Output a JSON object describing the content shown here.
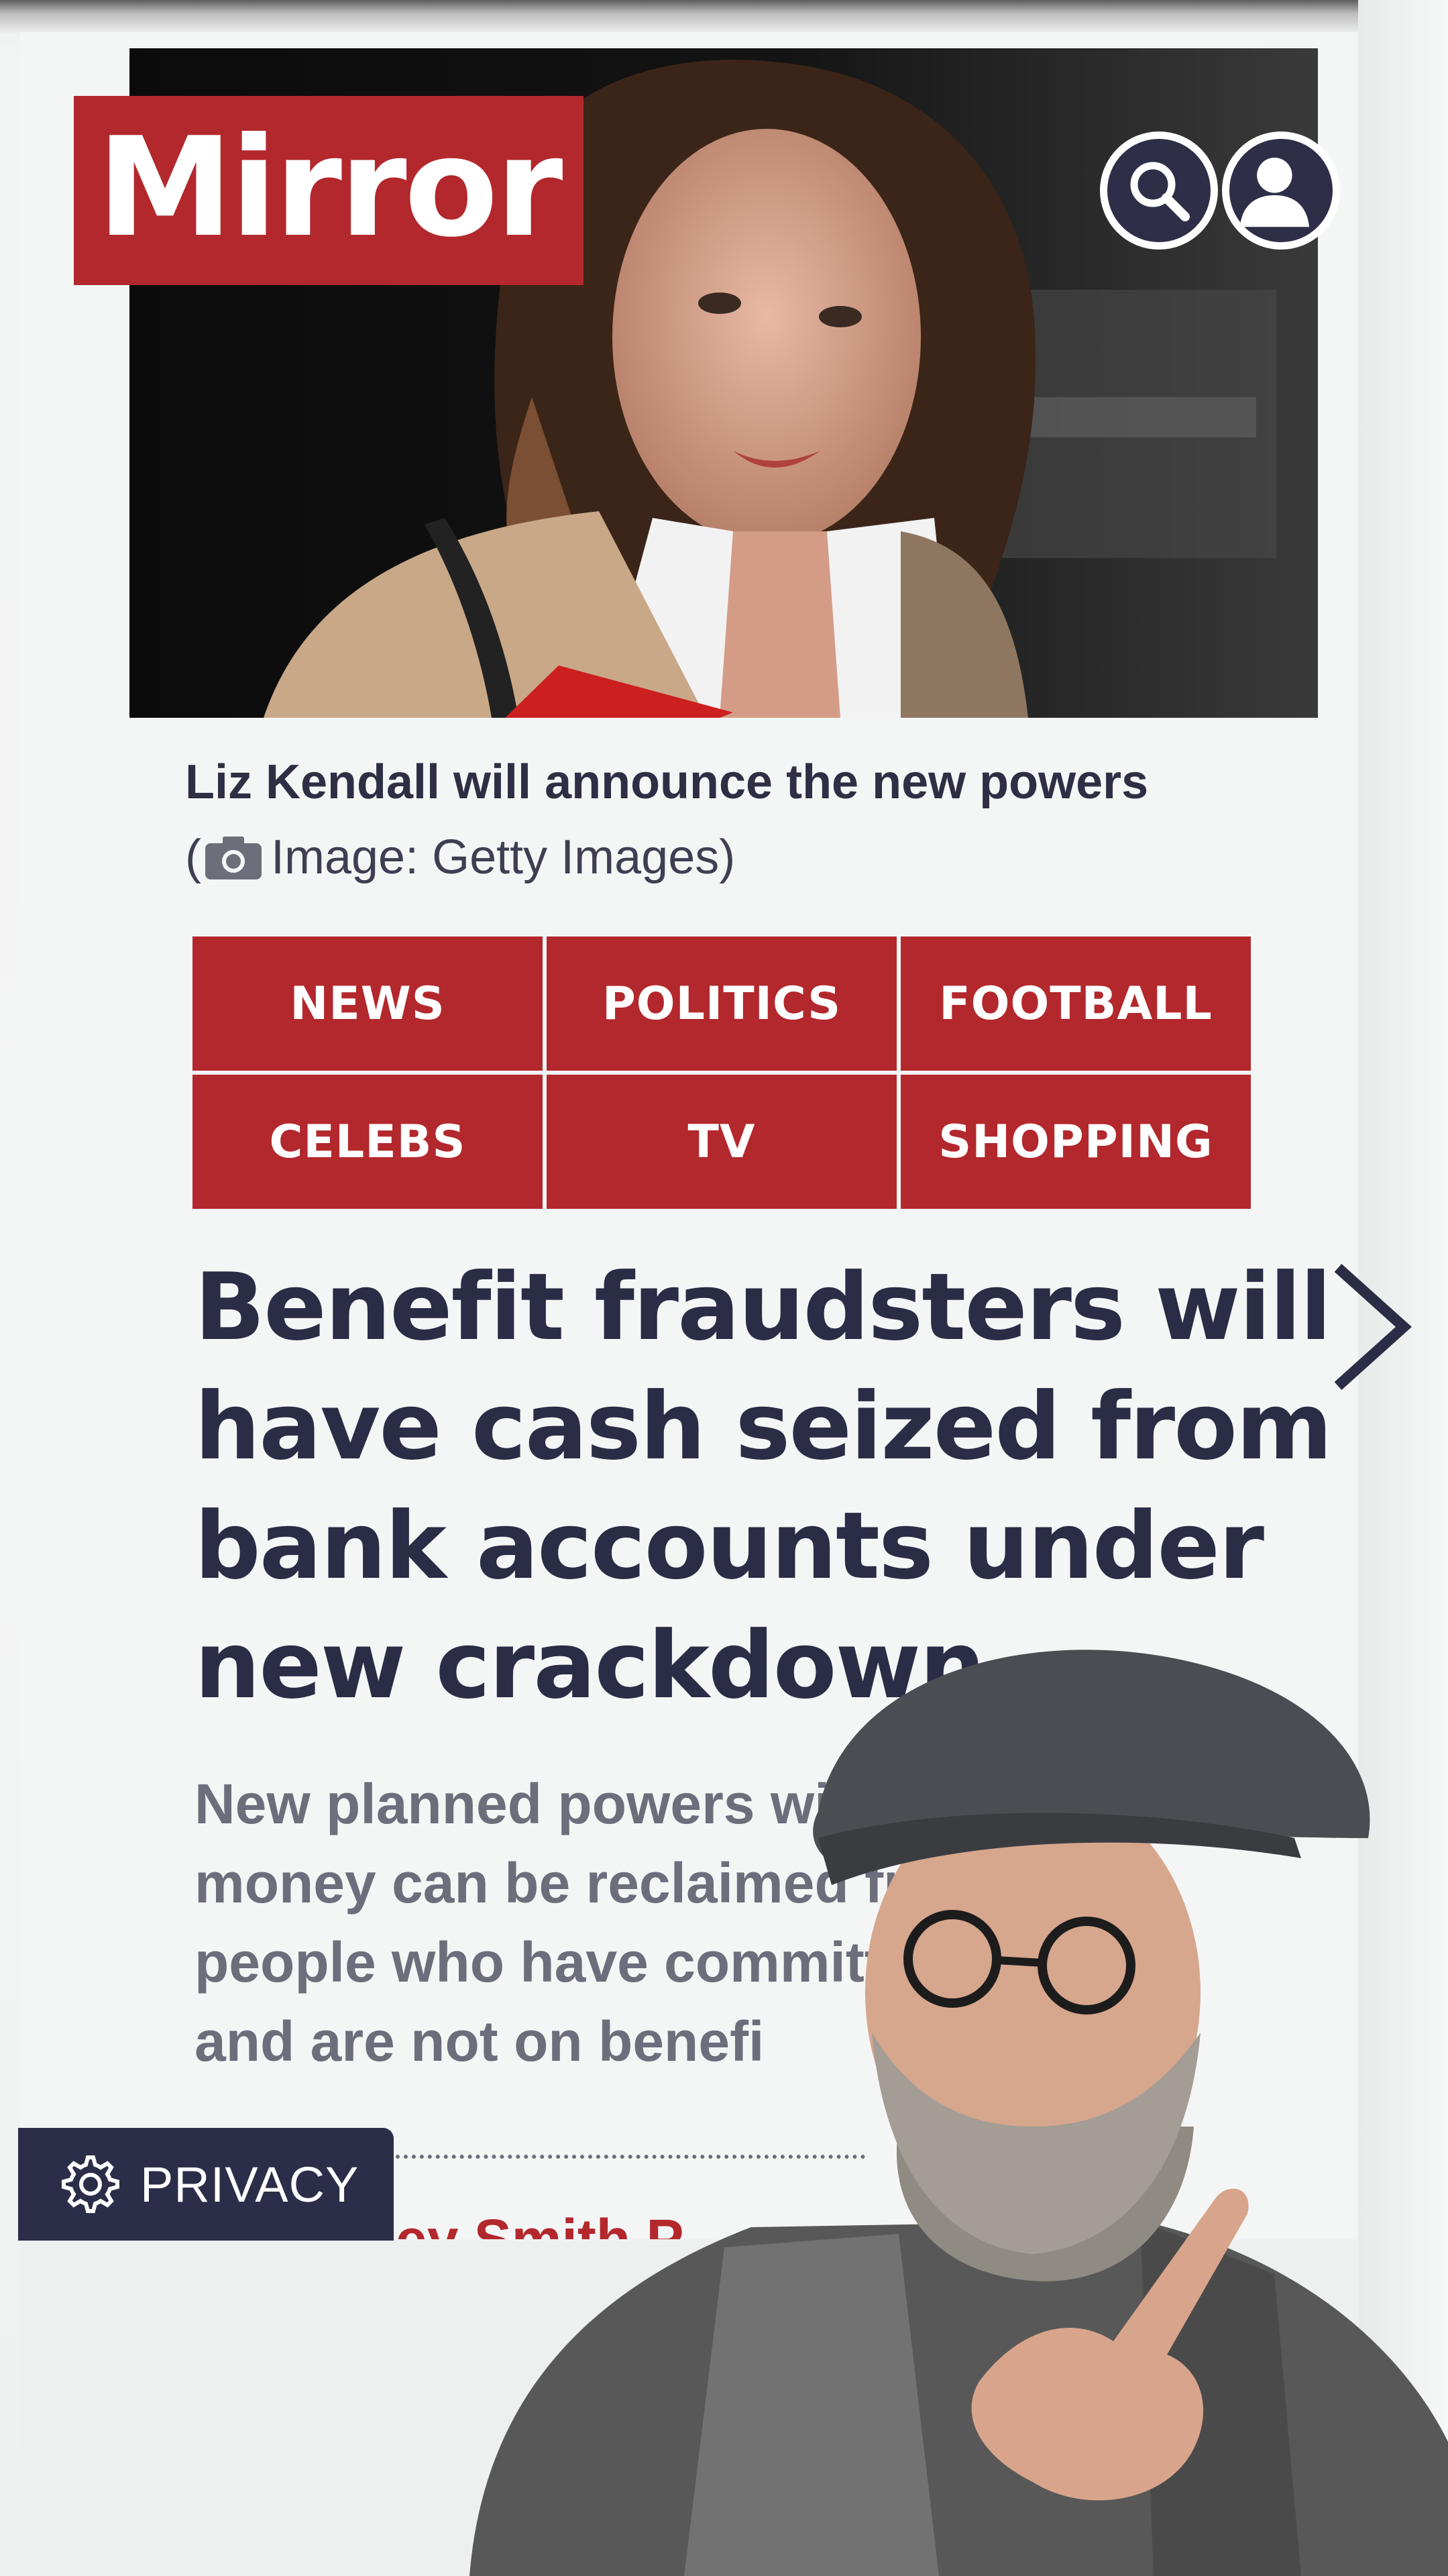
{
  "brand": {
    "logo_text": "Mirror",
    "accent_color": "#b3282d",
    "text_color": "#2b2c45"
  },
  "header": {
    "search_icon": "search-icon",
    "account_icon": "user-icon"
  },
  "hero": {
    "caption_title": "Liz Kendall will announce the new powers",
    "caption_open": "(",
    "caption_credit": "Image: Getty Images)",
    "camera_icon": "camera-icon"
  },
  "nav": {
    "items": [
      {
        "label": "NEWS"
      },
      {
        "label": "POLITICS"
      },
      {
        "label": "FOOTBALL"
      },
      {
        "label": "CELEBS"
      },
      {
        "label": "TV"
      },
      {
        "label": "SHOPPING"
      }
    ]
  },
  "article": {
    "headline_lines": [
      "Benefit fraudsters will",
      "have cash seized from",
      "bank accounts under",
      "new crackdown"
    ],
    "standfirst_lines": [
      "New planned powers will mea",
      "money can be reclaimed fror",
      "people who have committed",
      "and are not on benefi"
    ],
    "byline_partial": "ey Smith   P"
  },
  "privacy": {
    "label": "PRIVACY",
    "icon": "gear-icon"
  },
  "next_icon": "chevron-right-icon"
}
